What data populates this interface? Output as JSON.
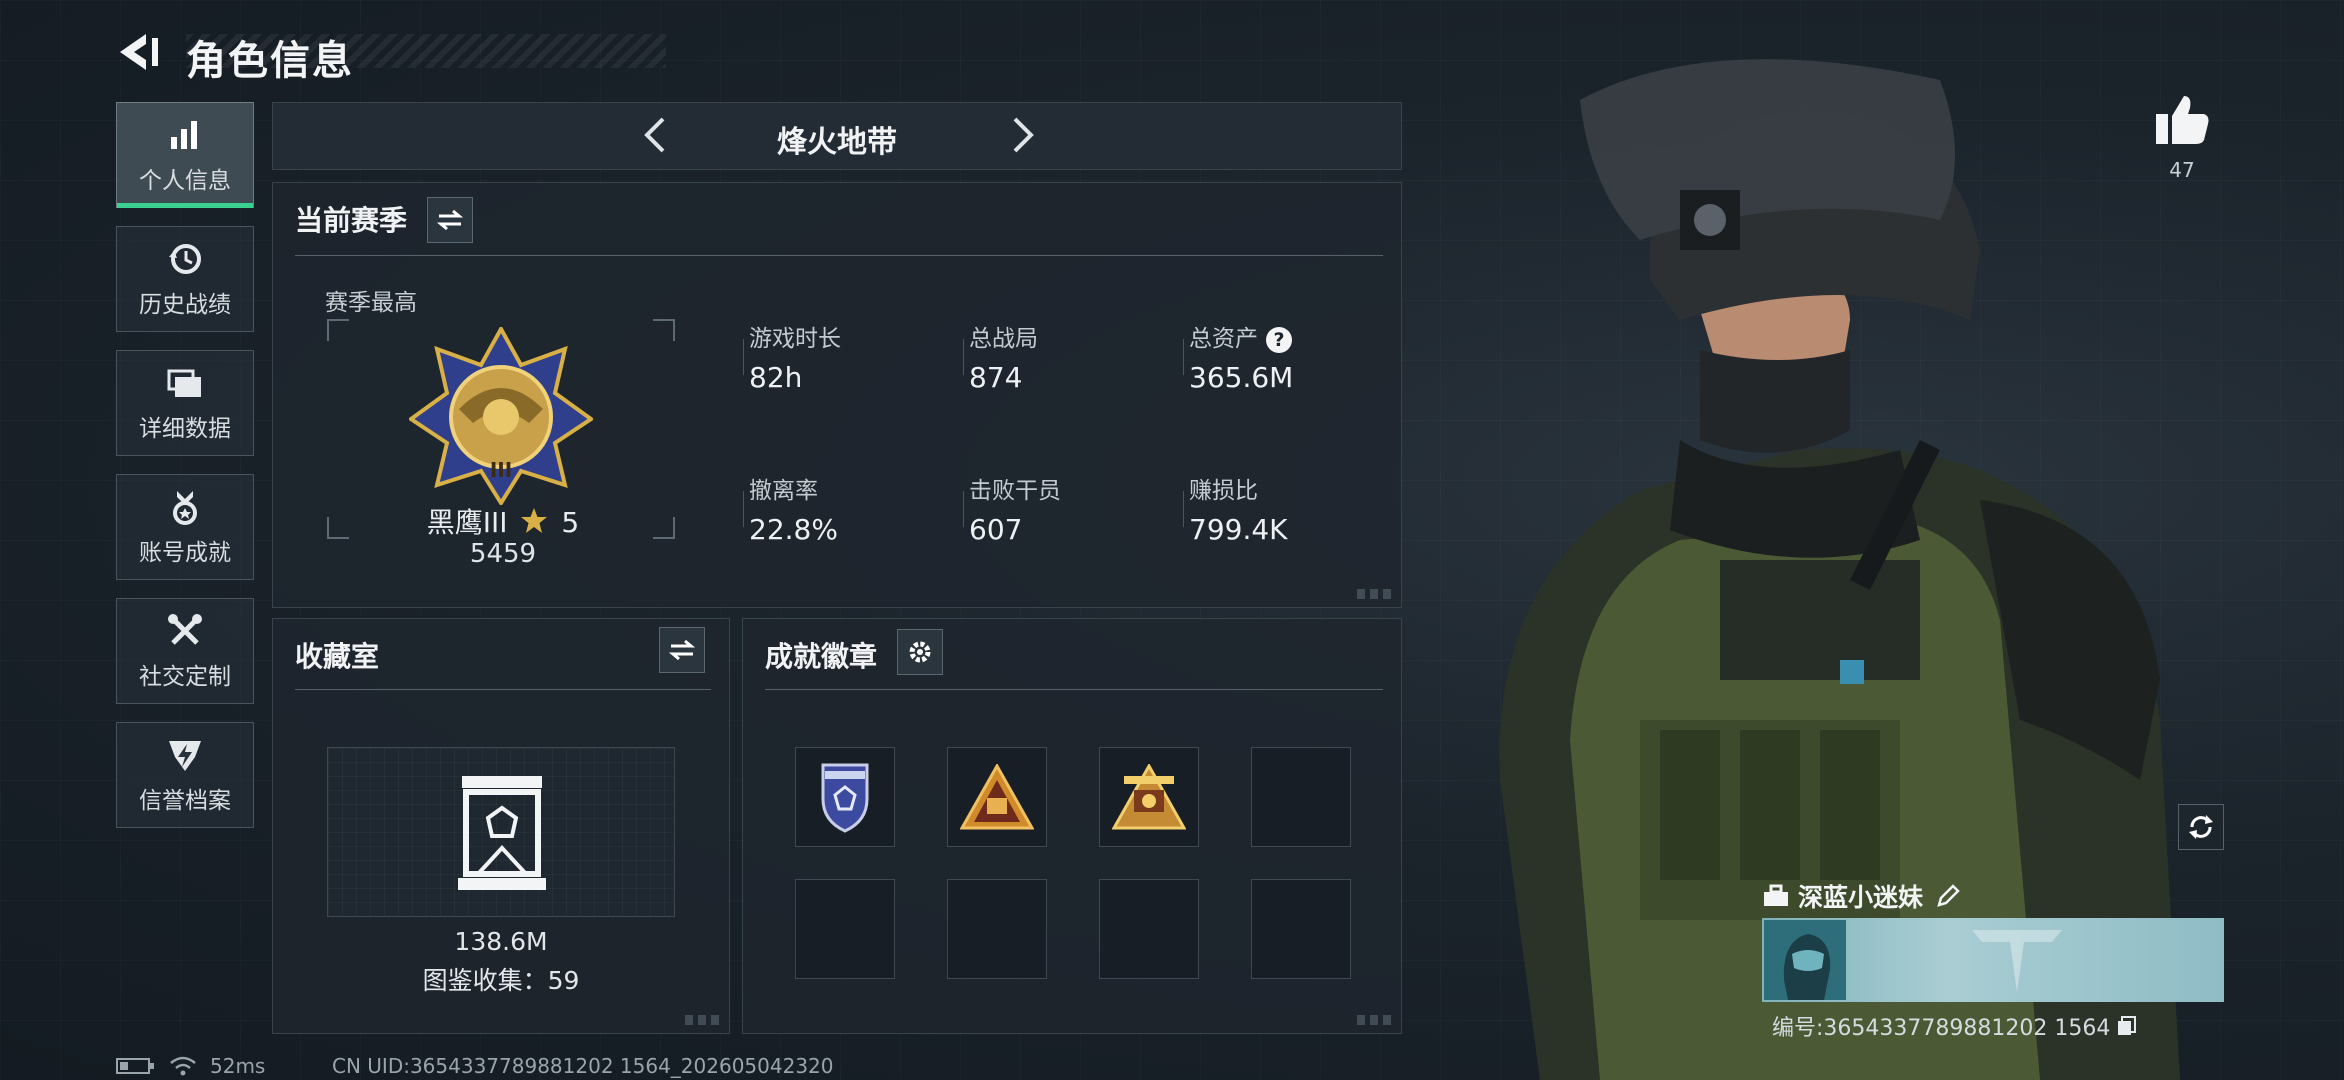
{
  "header": {
    "title": "角色信息"
  },
  "sidebar": {
    "items": [
      {
        "label": "个人信息",
        "icon": "bar-chart-icon",
        "active": true
      },
      {
        "label": "历史战绩",
        "icon": "history-clock-icon",
        "active": false
      },
      {
        "label": "详细数据",
        "icon": "folders-icon",
        "active": false
      },
      {
        "label": "账号成就",
        "icon": "medal-icon",
        "active": false
      },
      {
        "label": "社交定制",
        "icon": "tools-icon",
        "active": false
      },
      {
        "label": "信誉档案",
        "icon": "shield-bolt-icon",
        "active": false
      }
    ]
  },
  "mode_nav": {
    "title": "烽火地带"
  },
  "season": {
    "title": "当前赛季",
    "best_label": "赛季最高",
    "rank_name": "黑鹰III",
    "rank_stars": "5",
    "rank_score": "5459",
    "stats": [
      {
        "label": "游戏时长",
        "value": "82h"
      },
      {
        "label": "总战局",
        "value": "874"
      },
      {
        "label": "总资产",
        "value": "365.6M",
        "help": "?"
      },
      {
        "label": "撤离率",
        "value": "22.8%"
      },
      {
        "label": "击败干员",
        "value": "607"
      },
      {
        "label": "赚损比",
        "value": "799.4K"
      }
    ]
  },
  "collection": {
    "title": "收藏室",
    "value": "138.6M",
    "count_text": "图鉴收集：59"
  },
  "achievements": {
    "title": "成就徽章",
    "badges": [
      "police-badge-icon",
      "hazard-triangle-icon",
      "golden-emblem-icon",
      "",
      "",
      "",
      "",
      ""
    ]
  },
  "likes": {
    "count": "47"
  },
  "player": {
    "name": "深蓝小迷妹",
    "id_text": "编号:3654337789881202 1564"
  },
  "status": {
    "ping": "52ms",
    "uid": "CN UID:3654337789881202 1564_202605042320"
  },
  "colors": {
    "accent": "#3ad08f",
    "gold": "#d9b046",
    "bg": "#1a222a"
  }
}
